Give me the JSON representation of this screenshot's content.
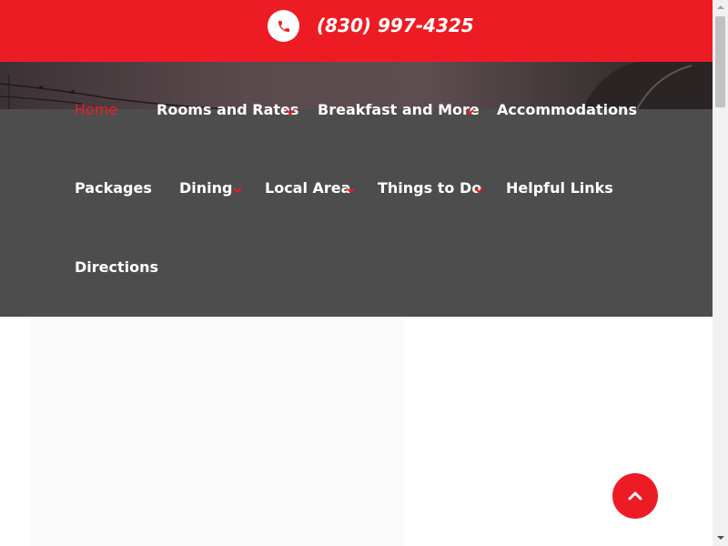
{
  "topbar": {
    "phone": "(830) 997-4325",
    "phone_icon": "phone-icon",
    "accent_color": "#ed1c24"
  },
  "nav": {
    "items": [
      {
        "label": "Home",
        "active": true,
        "dropdown": false
      },
      {
        "label": "Rooms and Rates",
        "active": false,
        "dropdown": true
      },
      {
        "label": "Breakfast and More",
        "active": false,
        "dropdown": true
      },
      {
        "label": "Accommodations",
        "active": false,
        "dropdown": false
      },
      {
        "label": "Packages",
        "active": false,
        "dropdown": false
      },
      {
        "label": "Dining",
        "active": false,
        "dropdown": true
      },
      {
        "label": "Local Area",
        "active": false,
        "dropdown": true
      },
      {
        "label": "Things to Do",
        "active": false,
        "dropdown": true
      },
      {
        "label": "Helpful Links",
        "active": false,
        "dropdown": false
      },
      {
        "label": "Directions",
        "active": false,
        "dropdown": false
      }
    ],
    "background_color": "#4d4d4d"
  },
  "scroll_top": {
    "icon": "chevron-up-icon"
  }
}
